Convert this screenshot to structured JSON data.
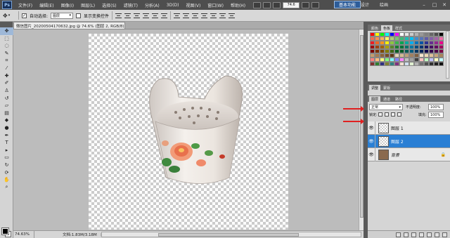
{
  "menubar": {
    "logo": "Ps",
    "items": [
      "文件(F)",
      "编辑(E)",
      "图像(I)",
      "图层(L)",
      "选择(S)",
      "滤镜(T)",
      "分析(A)",
      "3D(D)",
      "视图(V)",
      "窗口(W)",
      "帮助(H)"
    ],
    "zoom": "74.6",
    "workspace_active": "基本功能",
    "workspace_2": "设计",
    "workspace_3": "绘画",
    "window_controls": [
      "–",
      "□",
      "✕"
    ]
  },
  "options": {
    "auto_select_label": "自动选择:",
    "auto_select_value": "图层",
    "show_transform_label": "显示变换控件"
  },
  "document": {
    "tab_title": "微信图片_20200504170632.jpg @ 74.6% (图层 2, RGB/8) *",
    "tab_close": "×"
  },
  "statusbar": {
    "zoom": "74.63%",
    "doc_info": "文档:1.83M/3.18M",
    "arrow": "▶"
  },
  "panels": {
    "swatch_tabs": [
      "颜色",
      "色板",
      "样式"
    ],
    "active_swatch_tab": "色板",
    "adjust_tabs": [
      "调整",
      "蒙版"
    ],
    "layers_tabs": [
      "图层",
      "通道",
      "路径"
    ],
    "active_layers_tab": "图层",
    "blend_mode": "正常",
    "opacity_label": "不透明度:",
    "opacity": "100%",
    "lock_label": "锁定:",
    "fill_label": "填充:",
    "fill": "100%"
  },
  "layers": [
    {
      "name": "图层 1",
      "visible": true,
      "selected": false,
      "italic": false
    },
    {
      "name": "图层 2",
      "visible": true,
      "selected": true,
      "italic": false
    },
    {
      "name": "背景",
      "visible": true,
      "selected": false,
      "italic": true
    }
  ],
  "colors": {
    "menubar_bg": "#4e4e4e",
    "workspace_accent": "#2d5d9a",
    "selected_layer": "#2a7fd4",
    "annotation_arrow": "#e02020",
    "foreground": "#000000",
    "background": "#ffffff"
  },
  "swatches": [
    "#ff0000",
    "#ffff00",
    "#00ff00",
    "#00ffff",
    "#0000ff",
    "#ff00ff",
    "#ffffff",
    "#e6e6e6",
    "#cccccc",
    "#b3b3b3",
    "#999999",
    "#808080",
    "#666666",
    "#4d4d4d",
    "#000000",
    "#f26c4f",
    "#f68e56",
    "#fbaf5d",
    "#fff467",
    "#acd372",
    "#7cc576",
    "#3bb878",
    "#1abbb4",
    "#00bff3",
    "#438ccb",
    "#5574b9",
    "#605ca8",
    "#855fa8",
    "#a763a8",
    "#f06ea9",
    "#ed1c24",
    "#f26522",
    "#f7941d",
    "#fff200",
    "#8dc63f",
    "#39b54a",
    "#00a651",
    "#00a99d",
    "#00aeef",
    "#0072bc",
    "#0054a6",
    "#2e3192",
    "#662d91",
    "#92278f",
    "#ec008c",
    "#9e0b0f",
    "#a0410d",
    "#a36209",
    "#aba000",
    "#598527",
    "#197b30",
    "#007236",
    "#00746b",
    "#0076a3",
    "#004a80",
    "#003471",
    "#1b1464",
    "#440e62",
    "#630460",
    "#9e005d",
    "#790000",
    "#7b2e00",
    "#7d4900",
    "#827b00",
    "#406618",
    "#005e20",
    "#005826",
    "#005952",
    "#005b7f",
    "#003663",
    "#002157",
    "#0d004c",
    "#32004b",
    "#4b0049",
    "#7b0046",
    "#c69c6d",
    "#a67c52",
    "#8c6239",
    "#754c24",
    "#603913",
    "#e6d6b8",
    "#d4bb94",
    "#bda079",
    "#a08060",
    "#806040",
    "#f5e7d0",
    "#efd9b4",
    "#e0c29a",
    "#c9a47a",
    "#a9855b",
    "#ff8080",
    "#ffbf80",
    "#ffff80",
    "#80ff80",
    "#80ffff",
    "#8080ff",
    "#ff80ff",
    "#c0c0c0",
    "#a0a0a0",
    "#404040",
    "#ffc0c0",
    "#c0ffc0",
    "#c0c0ff",
    "#ffffc0",
    "#c0ffff",
    "#803030",
    "#308030",
    "#303080",
    "#808030",
    "#308080",
    "#803080",
    "#f0e0d0",
    "#d0e0f0",
    "#e0f0d0",
    "#b0b0b0",
    "#707070",
    "#505050",
    "#303030",
    "#202020",
    "#101010"
  ]
}
